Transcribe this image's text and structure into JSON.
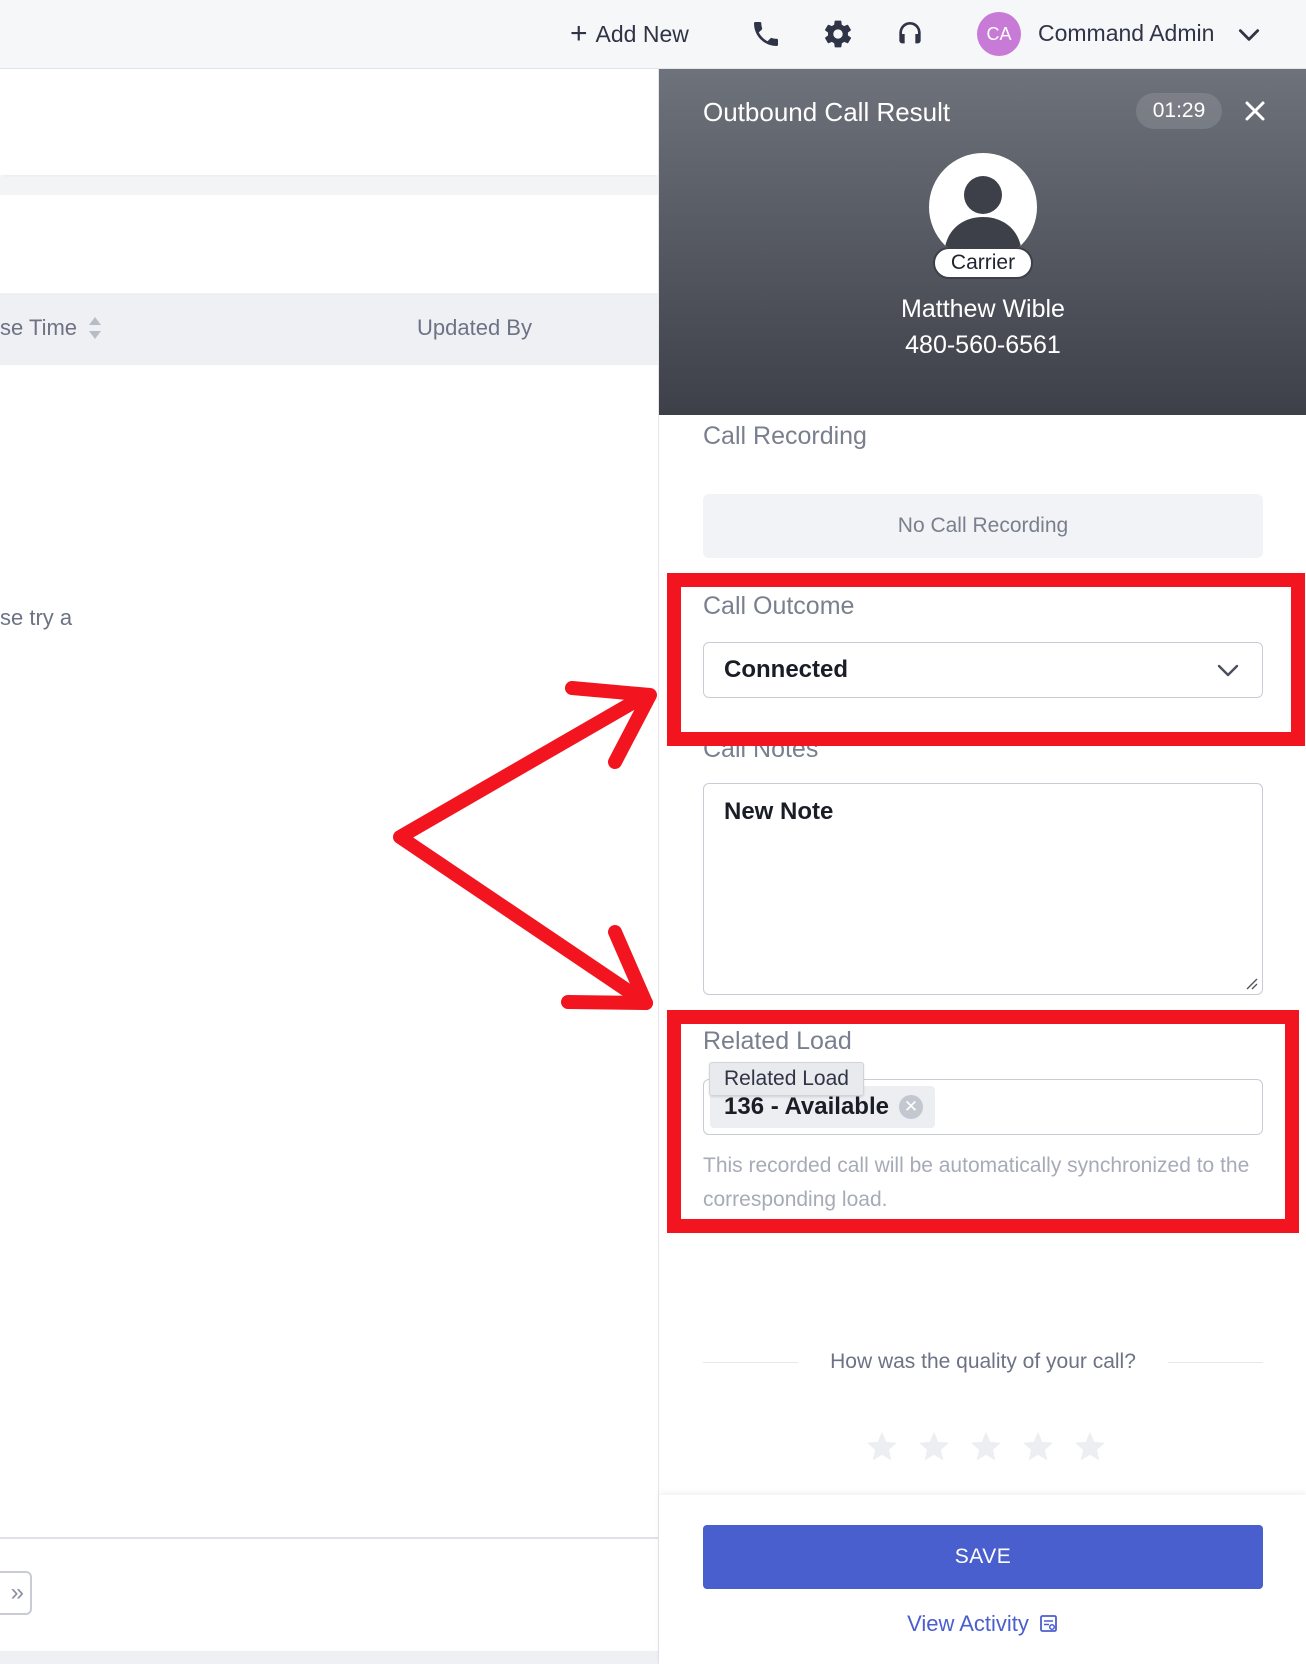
{
  "topbar": {
    "add_new_label": "Add New",
    "icons": [
      "plus-icon",
      "phone-icon",
      "gear-icon",
      "headset-icon",
      "chevron-down-icon"
    ],
    "user_initials": "CA",
    "user_name": "Command Admin"
  },
  "background_page": {
    "columns": [
      "se Time",
      "Updated By"
    ],
    "empty_text": "se try a",
    "pager_label": "»"
  },
  "panel": {
    "title": "Outbound Call Result",
    "timer": "01:29",
    "contact_type": "Carrier",
    "contact_name": "Matthew Wible",
    "contact_phone": "480-560-6561",
    "call_recording_label": "Call Recording",
    "call_recording_value": "No Call Recording",
    "call_outcome_label": "Call Outcome",
    "call_outcome_value": "Connected",
    "call_notes_label": "Call Notes",
    "call_notes_value": "New Note",
    "related_load_label": "Related Load",
    "related_load_chip": "136 - Available",
    "related_load_tooltip": "Related Load",
    "sync_text": "This recorded call will be automatically synchronized to the corresponding load.",
    "quality_question": "How was the quality of your call?",
    "rating": {
      "value": 0,
      "max": 5
    },
    "save_label": "SAVE",
    "view_activity_label": "View Activity"
  },
  "colors": {
    "accent": "#4a5fce",
    "highlight": "#f2151f",
    "avatar": "#c77ad6",
    "header_gradient_top": "#6e727b",
    "header_gradient_bottom": "#3d4048"
  }
}
